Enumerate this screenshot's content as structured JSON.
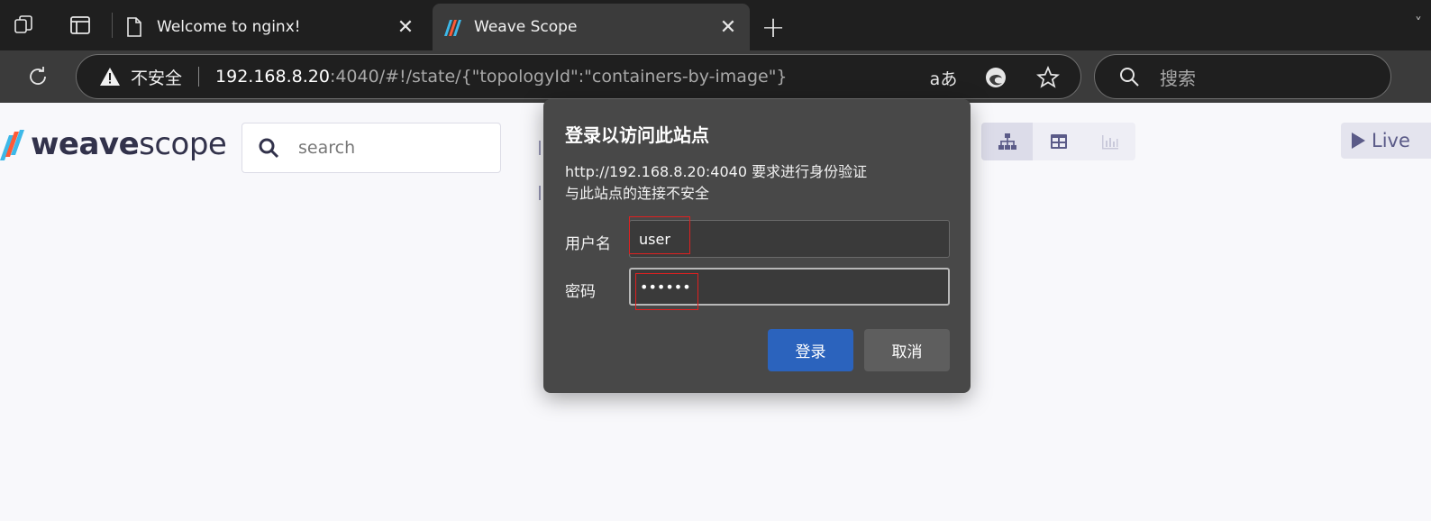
{
  "browser": {
    "tabs": [
      {
        "title": "Welcome to nginx!",
        "active": false
      },
      {
        "title": "Weave Scope",
        "active": true
      }
    ],
    "address": {
      "security_label": "不安全",
      "url_host": "192.168.8.20",
      "url_rest": ":4040/#!/state/{\"topologyId\":\"containers-by-image\"}"
    },
    "search_placeholder": "搜索",
    "icons": {
      "workspaces": "workspaces-icon",
      "tab_actions": "tab-actions-icon",
      "reload": "reload-icon",
      "read_aloud": "read-aloud-icon",
      "edge": "edge-icon",
      "favorite": "favorite-star-icon",
      "search": "search-icon"
    },
    "read_aloud_glyph": "aあ"
  },
  "scope": {
    "logo_bold": "weave",
    "logo_light": "scope",
    "search_placeholder": "search",
    "live_label": "Live",
    "colors": {
      "logo_text": "#32324b",
      "accent": "#5b5b88"
    }
  },
  "auth_dialog": {
    "title": "登录以访问此站点",
    "message_line1": "http://192.168.8.20:4040 要求进行身份验证",
    "message_line2": "与此站点的连接不安全",
    "username_label": "用户名",
    "username_value": "user",
    "password_label": "密码",
    "password_value": "••••••",
    "login_button": "登录",
    "cancel_button": "取消",
    "colors": {
      "login_button": "#2b63bd",
      "highlight_box": "#e02020"
    }
  }
}
